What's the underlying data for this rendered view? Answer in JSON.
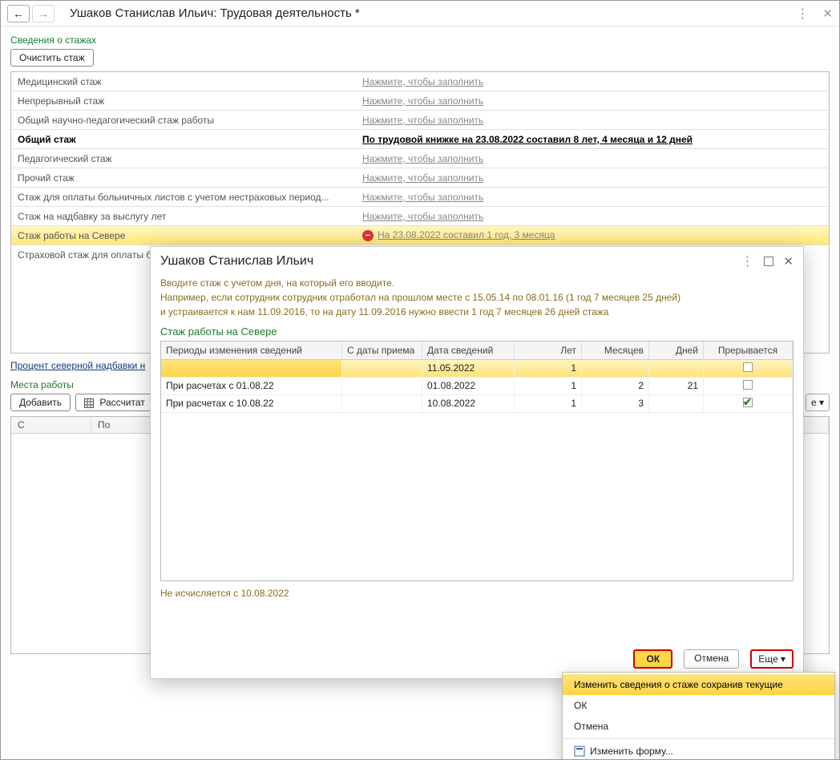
{
  "header": {
    "title": "Ушаков Станислав Ильич: Трудовая деятельность *"
  },
  "section_stages": {
    "label": "Сведения о стажах",
    "clear_btn": "Очистить стаж",
    "fill_hint": "Нажмите, чтобы заполнить",
    "rows": [
      {
        "name": "Медицинский стаж"
      },
      {
        "name": "Непрерывный стаж"
      },
      {
        "name": "Общий научно-педагогический стаж работы"
      },
      {
        "name": "Общий стаж",
        "bold": true,
        "value": "По трудовой книжке на 23.08.2022 составил 8 лет, 4 месяца и 12 дней"
      },
      {
        "name": "Педагогический стаж"
      },
      {
        "name": "Прочий стаж"
      },
      {
        "name": "Стаж для оплаты больничных листов с учетом нестраховых период..."
      },
      {
        "name": "Стаж на надбавку за выслугу лет"
      },
      {
        "name": "Стаж работы на Севере",
        "hl": true,
        "value": "На 23.08.2022 составил 1 год, 3 месяца",
        "err": true
      },
      {
        "name": "Страховой стаж для оплаты б"
      }
    ],
    "percent_link": "Процент северной надбавки н"
  },
  "section_places": {
    "label": "Места работы",
    "add_btn": "Добавить",
    "calc_btn": "Рассчитат",
    "more": "е ▾",
    "cols": {
      "c": "С",
      "po": "По"
    }
  },
  "popup": {
    "title": "Ушаков Станислав Ильич",
    "hint_l1": "Вводите стаж с учетом дня, на который его вводите.",
    "hint_l2": "Например, если сотрудник сотрудник отработал на прошлом месте с 15.05.14 по 08.01.16 (1 год 7 месяцев 25 дней)",
    "hint_l3": "и устраивается к нам 11.09.2016, то на дату 11.09.2016 нужно ввести 1 год 7 месяцев 26 дней стажа",
    "section": "Стаж работы на Севере",
    "hdr": {
      "per": "Периоды изменения сведений",
      "prm": "С даты приема",
      "dt": "Дата сведений",
      "yr": "Лет",
      "mo": "Месяцев",
      "dy": "Дней",
      "br": "Прерывается"
    },
    "rows": [
      {
        "per": "",
        "prm": "",
        "dt": "11.05.2022",
        "yr": "1",
        "mo": "",
        "dy": "",
        "br": false,
        "sel": true
      },
      {
        "per": "При расчетах с  01.08.22",
        "prm": "",
        "dt": "01.08.2022",
        "yr": "1",
        "mo": "2",
        "dy": "21",
        "br": false
      },
      {
        "per": "При расчетах с  10.08.22",
        "prm": "",
        "dt": "10.08.2022",
        "yr": "1",
        "mo": "3",
        "dy": "",
        "br": true
      }
    ],
    "note": "Не исчисляется с 10.08.2022",
    "btns": {
      "ok": "ОК",
      "cancel": "Отмена",
      "more": "Еще ▾"
    }
  },
  "menu": {
    "items": [
      {
        "label": "Изменить сведения о стаже сохранив текущие",
        "hl": true
      },
      {
        "label": "ОК"
      },
      {
        "label": "Отмена"
      },
      {
        "label": "Изменить форму...",
        "icon": true,
        "sep": true
      }
    ]
  }
}
